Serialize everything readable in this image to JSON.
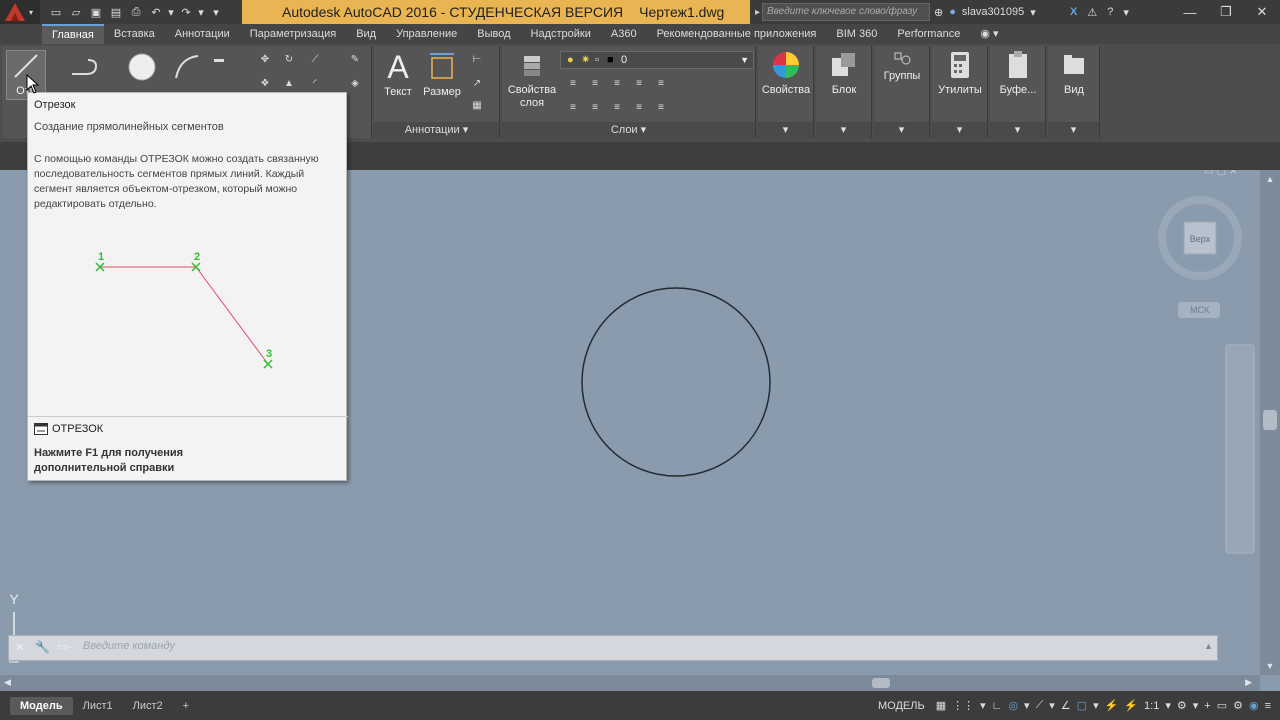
{
  "titlebar": {
    "quick_access": [
      "new-icon",
      "open-icon",
      "save-icon",
      "save-as-icon",
      "print-icon",
      "undo-icon",
      "undo-dropdown",
      "redo-icon",
      "redo-dropdown",
      "customize-icon"
    ],
    "app_title": "Autodesk AutoCAD 2016 - СТУДЕНЧЕСКАЯ ВЕРСИЯ",
    "file_name": "Чертеж1.dwg",
    "search_placeholder": "Введите ключевое слово/фразу",
    "username": "slava301095",
    "accent": "#e9b452"
  },
  "menu": {
    "tabs": [
      "Главная",
      "Вставка",
      "Аннотации",
      "Параметризация",
      "Вид",
      "Управление",
      "Вывод",
      "Надстройки",
      "A360",
      "Рекомендованные приложения",
      "BIM 360",
      "Performance"
    ],
    "active": "Главная"
  },
  "ribbon": {
    "line_label_partial": "Отр",
    "text_label": "Текст",
    "dimension_label": "Размер",
    "layer_props_label": "Свойства слоя",
    "annotations_panel": "Аннотации",
    "layers_panel": "Слои",
    "layer_current": "0",
    "properties_label": "Свойства",
    "block_label": "Блок",
    "groups_label": "Группы",
    "utilities_label": "Утилиты",
    "clipboard_label": "Буфе...",
    "view_label": "Вид"
  },
  "tooltip": {
    "title": "Отрезок",
    "subtitle": "Создание прямолинейных сегментов",
    "description": "С помощью команды ОТРЕЗОК можно создать связанную последовательность сегментов прямых линий. Каждый сегмент является объектом-отрезком, который можно редактировать отдельно.",
    "points": [
      "1",
      "2",
      "3"
    ],
    "command": "ОТРЕЗОК",
    "help": "Нажмите F1 для получения дополнительной справки",
    "line_color": "#e0506a",
    "point_color": "#33bb33"
  },
  "viewcube": {
    "face": "Верх",
    "ucs": "МСК"
  },
  "ucs_icon": {
    "y_label": "Y"
  },
  "command_line": {
    "placeholder": "Введите команду"
  },
  "layout_tabs": [
    "Модель",
    "Лист1",
    "Лист2"
  ],
  "status": {
    "model": "МОДЕЛЬ",
    "scale": "1:1"
  }
}
